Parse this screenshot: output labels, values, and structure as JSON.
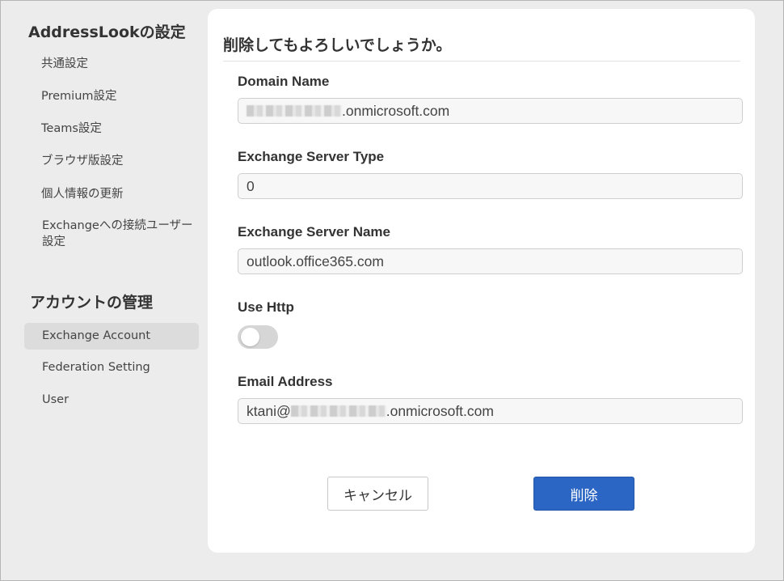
{
  "sidebar": {
    "settings_heading": "AddressLookの設定",
    "settings_items": [
      {
        "label": "共通設定"
      },
      {
        "label": "Premium設定"
      },
      {
        "label": "Teams設定"
      },
      {
        "label": "ブラウザ版設定"
      },
      {
        "label": "個人情報の更新"
      },
      {
        "label": "Exchangeへの接続ユーザー設定"
      }
    ],
    "account_heading": "アカウントの管理",
    "account_items": [
      {
        "label": "Exchange Account",
        "active": true
      },
      {
        "label": "Federation Setting"
      },
      {
        "label": "User"
      }
    ]
  },
  "form": {
    "title": "削除してもよろしいでしょうか。",
    "domain_name": {
      "label": "Domain Name",
      "value_suffix": ".onmicrosoft.com"
    },
    "server_type": {
      "label": "Exchange Server Type",
      "value": "0"
    },
    "server_name": {
      "label": "Exchange Server Name",
      "value": "outlook.office365.com"
    },
    "use_http": {
      "label": "Use Http",
      "on": false
    },
    "email": {
      "label": "Email Address",
      "value_prefix": "ktani@",
      "value_suffix": ".onmicrosoft.com"
    },
    "cancel_label": "キャンセル",
    "delete_label": "削除"
  },
  "colors": {
    "primary_button": "#2b66c4",
    "background": "#ececec",
    "panel": "#ffffff"
  }
}
